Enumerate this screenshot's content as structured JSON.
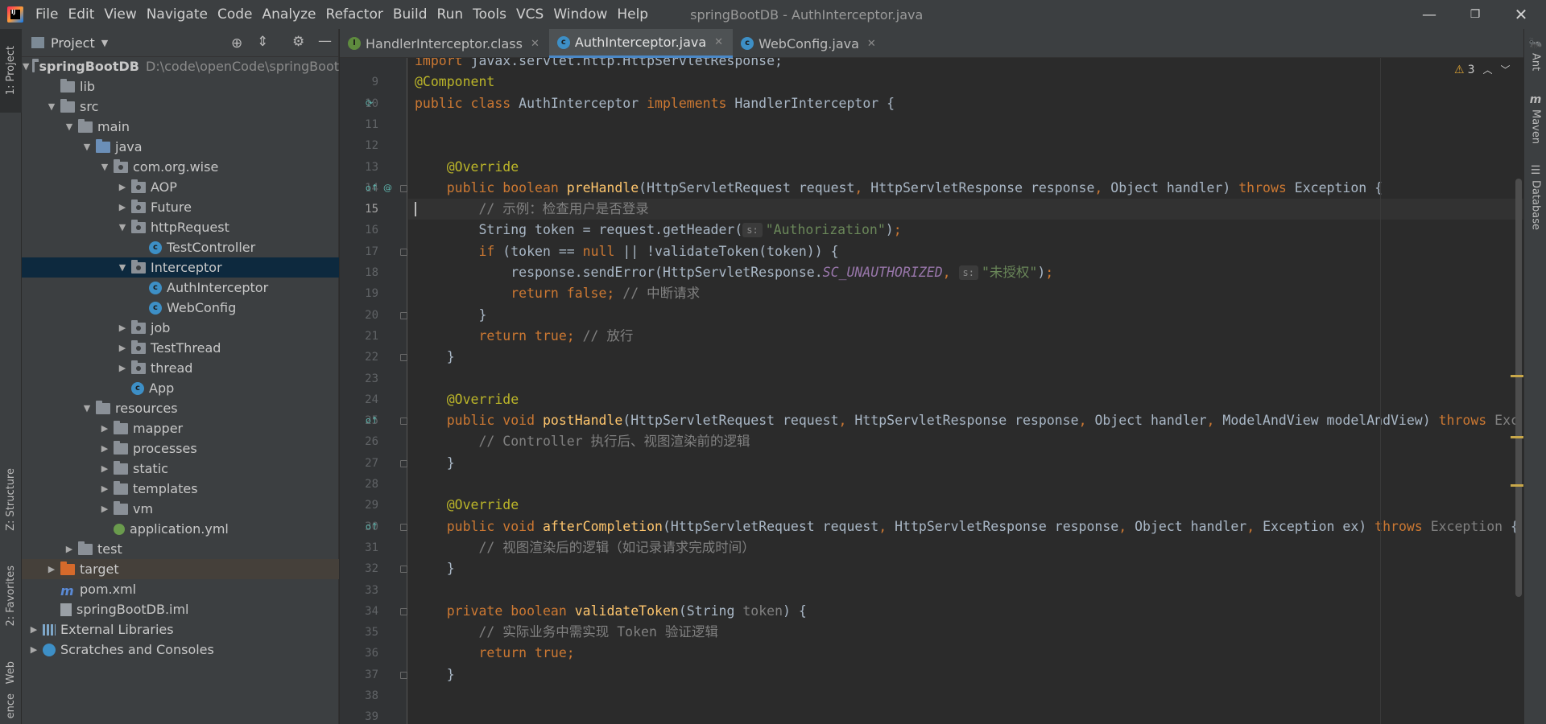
{
  "menu": [
    "File",
    "Edit",
    "View",
    "Navigate",
    "Code",
    "Analyze",
    "Refactor",
    "Build",
    "Run",
    "Tools",
    "VCS",
    "Window",
    "Help"
  ],
  "window_title": "springBootDB - AuthInterceptor.java",
  "left_tabs": {
    "project": "1: Project",
    "structure": "Z: Structure",
    "favorites": "2: Favorites",
    "web": "Web",
    "persistence": "ence"
  },
  "right_tabs": {
    "ant": "Ant",
    "maven": "Maven",
    "database": "Database"
  },
  "project_panel": {
    "title": "Project",
    "tree": [
      {
        "label": "springBootDB",
        "extra": "D:\\code\\openCode\\springBoot",
        "depth": 0,
        "arrow": "down",
        "icon": "folder"
      },
      {
        "label": "lib",
        "depth": 1,
        "arrow": "",
        "icon": "folder"
      },
      {
        "label": "src",
        "depth": 1,
        "arrow": "down",
        "icon": "folder"
      },
      {
        "label": "main",
        "depth": 2,
        "arrow": "down",
        "icon": "folder"
      },
      {
        "label": "java",
        "depth": 3,
        "arrow": "down",
        "icon": "src"
      },
      {
        "label": "com.org.wise",
        "depth": 4,
        "arrow": "down",
        "icon": "pkg"
      },
      {
        "label": "AOP",
        "depth": 5,
        "arrow": "right",
        "icon": "pkg"
      },
      {
        "label": "Future",
        "depth": 5,
        "arrow": "right",
        "icon": "pkg"
      },
      {
        "label": "httpRequest",
        "depth": 5,
        "arrow": "down",
        "icon": "pkg"
      },
      {
        "label": "TestController",
        "depth": 6,
        "arrow": "",
        "icon": "class"
      },
      {
        "label": "Interceptor",
        "depth": 5,
        "arrow": "down",
        "icon": "pkg",
        "selected": true
      },
      {
        "label": "AuthInterceptor",
        "depth": 6,
        "arrow": "",
        "icon": "class"
      },
      {
        "label": "WebConfig",
        "depth": 6,
        "arrow": "",
        "icon": "class"
      },
      {
        "label": "job",
        "depth": 5,
        "arrow": "right",
        "icon": "pkg"
      },
      {
        "label": "TestThread",
        "depth": 5,
        "arrow": "right",
        "icon": "pkg"
      },
      {
        "label": "thread",
        "depth": 5,
        "arrow": "right",
        "icon": "pkg"
      },
      {
        "label": "App",
        "depth": 5,
        "arrow": "",
        "icon": "class"
      },
      {
        "label": "resources",
        "depth": 3,
        "arrow": "down",
        "icon": "res"
      },
      {
        "label": "mapper",
        "depth": 4,
        "arrow": "right",
        "icon": "folder"
      },
      {
        "label": "processes",
        "depth": 4,
        "arrow": "right",
        "icon": "folder"
      },
      {
        "label": "static",
        "depth": 4,
        "arrow": "right",
        "icon": "folder"
      },
      {
        "label": "templates",
        "depth": 4,
        "arrow": "right",
        "icon": "folder"
      },
      {
        "label": "vm",
        "depth": 4,
        "arrow": "right",
        "icon": "folder"
      },
      {
        "label": "application.yml",
        "depth": 4,
        "arrow": "",
        "icon": "yml"
      },
      {
        "label": "test",
        "depth": 2,
        "arrow": "right",
        "icon": "folder"
      },
      {
        "label": "target",
        "depth": 1,
        "arrow": "right",
        "icon": "target",
        "highlight": true
      },
      {
        "label": "pom.xml",
        "depth": 1,
        "arrow": "",
        "icon": "pom"
      },
      {
        "label": "springBootDB.iml",
        "depth": 1,
        "arrow": "",
        "icon": "file"
      },
      {
        "label": "External Libraries",
        "depth": 0,
        "arrow": "right",
        "icon": "lib"
      },
      {
        "label": "Scratches and Consoles",
        "depth": 0,
        "arrow": "right",
        "icon": "scratch"
      }
    ]
  },
  "editor_tabs": [
    {
      "label": "HandlerInterceptor.class",
      "icon": "interface",
      "active": false
    },
    {
      "label": "AuthInterceptor.java",
      "icon": "class",
      "active": true
    },
    {
      "label": "WebConfig.java",
      "icon": "class",
      "active": false
    }
  ],
  "inspection": {
    "warnings": "3"
  },
  "current_line": 15,
  "code_lines": [
    {
      "n": "",
      "html": "<span class=\"k\">import</span> javax.servlet.http.HttpServletResponse;"
    },
    {
      "n": "9",
      "html": "<span class=\"an\">@Component</span>"
    },
    {
      "n": "10",
      "html": "<span class=\"k\">public class </span>AuthInterceptor <span class=\"k\">implements </span>HandlerInterceptor {"
    },
    {
      "n": "11",
      "html": ""
    },
    {
      "n": "12",
      "html": ""
    },
    {
      "n": "13",
      "html": "    <span class=\"an\">@Override</span>"
    },
    {
      "n": "14",
      "html": "    <span class=\"k\">public boolean </span><span class=\"fn\">preHandle</span>(HttpServletRequest request<span class=\"k\">, </span>HttpServletResponse response<span class=\"k\">, </span>Object handler) <span class=\"k\">throws </span>Exception {"
    },
    {
      "n": "15",
      "html": "        <span class=\"cm\">// 示例：检查用户是否登录</span>"
    },
    {
      "n": "16",
      "html": "        String token = request.getHeader(<span class=\"hint\">s:</span><span class=\"st\">\"Authorization\"</span>)<span class=\"k\">;</span>"
    },
    {
      "n": "17",
      "html": "        <span class=\"k\">if </span>(token == <span class=\"k\">null </span>|| !validateToken(token)) {"
    },
    {
      "n": "18",
      "html": "            response.sendError(HttpServletResponse.<span class=\"cn\">SC_UNAUTHORIZED</span><span class=\"k\">, </span><span class=\"hint\">s:</span><span class=\"st\">\"未授权\"</span>)<span class=\"k\">;</span>"
    },
    {
      "n": "19",
      "html": "            <span class=\"k\">return false; </span><span class=\"cm\">// 中断请求</span>"
    },
    {
      "n": "20",
      "html": "        }"
    },
    {
      "n": "21",
      "html": "        <span class=\"k\">return true; </span><span class=\"cm\">// 放行</span>"
    },
    {
      "n": "22",
      "html": "    }"
    },
    {
      "n": "23",
      "html": ""
    },
    {
      "n": "24",
      "html": "    <span class=\"an\">@Override</span>"
    },
    {
      "n": "25",
      "html": "    <span class=\"k\">public void </span><span class=\"fn\">postHandle</span>(HttpServletRequest request<span class=\"k\">, </span>HttpServletResponse response<span class=\"k\">, </span>Object handler<span class=\"k\">, </span>ModelAndView modelAndView) <span class=\"k\">throws </span><span class=\"cm\">Exc</span>"
    },
    {
      "n": "26",
      "html": "        <span class=\"cm\">// Controller 执行后、视图渲染前的逻辑</span>"
    },
    {
      "n": "27",
      "html": "    }"
    },
    {
      "n": "28",
      "html": ""
    },
    {
      "n": "29",
      "html": "    <span class=\"an\">@Override</span>"
    },
    {
      "n": "30",
      "html": "    <span class=\"k\">public void </span><span class=\"fn\">afterCompletion</span>(HttpServletRequest request<span class=\"k\">, </span>HttpServletResponse response<span class=\"k\">, </span>Object handler<span class=\"k\">, </span>Exception ex) <span class=\"k\">throws </span><span class=\"cm\">Exception</span> {"
    },
    {
      "n": "31",
      "html": "        <span class=\"cm\">// 视图渲染后的逻辑（如记录请求完成时间）</span>"
    },
    {
      "n": "32",
      "html": "    }"
    },
    {
      "n": "33",
      "html": ""
    },
    {
      "n": "34",
      "html": "    <span class=\"k\">private boolean </span><span class=\"fn\">validateToken</span>(String <span class=\"cm\">token</span>) {"
    },
    {
      "n": "35",
      "html": "        <span class=\"cm\">// 实际业务中需实现 Token 验证逻辑</span>"
    },
    {
      "n": "36",
      "html": "        <span class=\"k\">return true;</span>"
    },
    {
      "n": "37",
      "html": "    }"
    },
    {
      "n": "38",
      "html": ""
    },
    {
      "n": "39",
      "html": ""
    }
  ]
}
